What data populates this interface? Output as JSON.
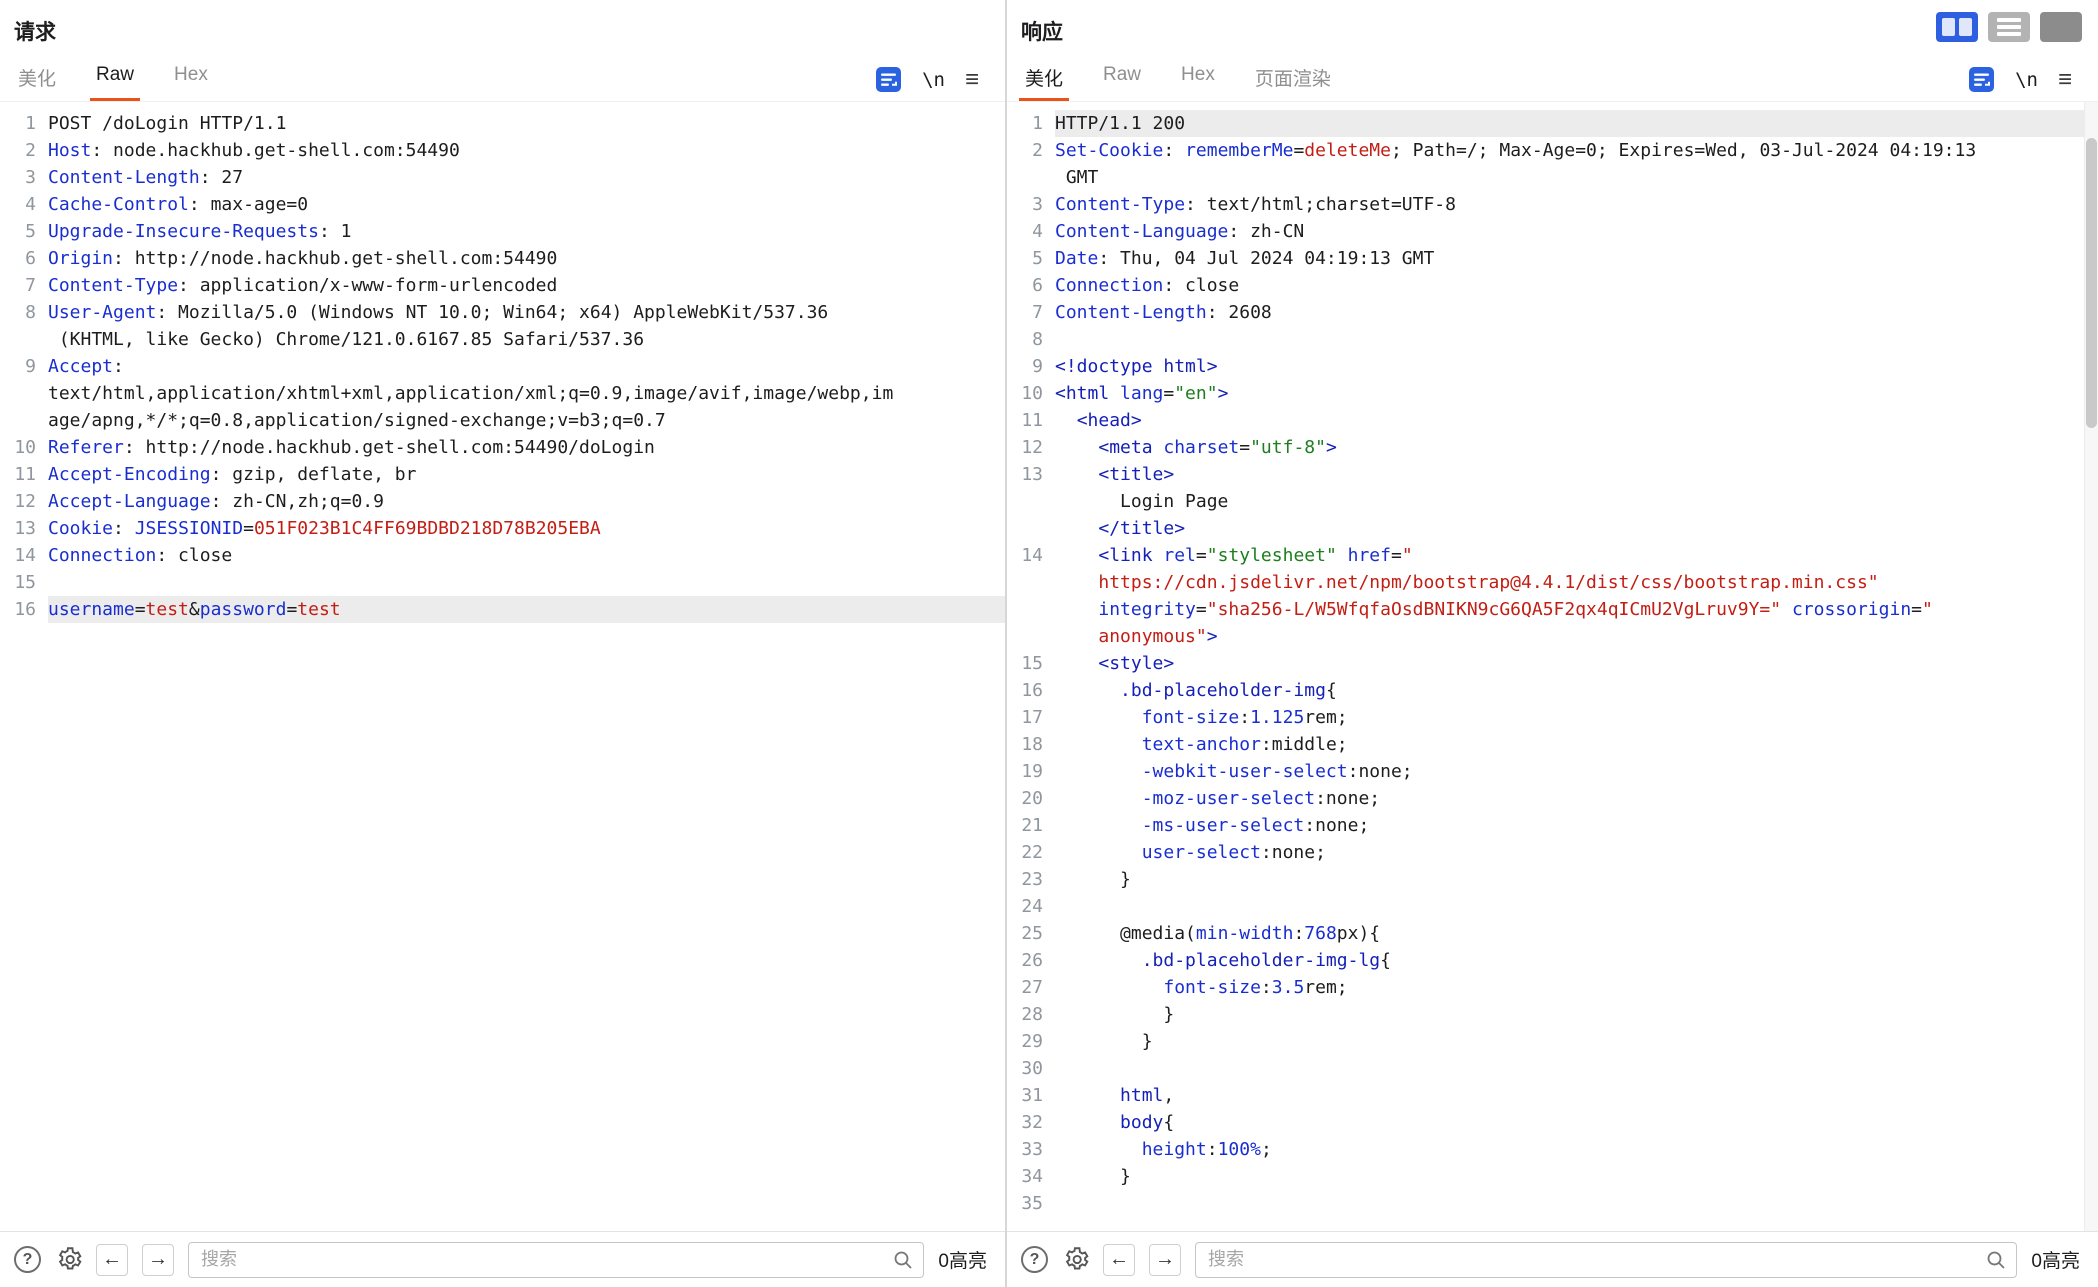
{
  "accent_color": "#e8531a",
  "icon_blue": "#2b62e0",
  "layout_toggles": {
    "split": "two-column-view",
    "rows": "stacked-view",
    "single": "single-view"
  },
  "glyphs": {
    "help": "?",
    "back": "←",
    "forward": "→",
    "menu": "≡",
    "newline": "\\n"
  },
  "request": {
    "title": "请求",
    "tabs": [
      {
        "label": "美化"
      },
      {
        "label": "Raw"
      },
      {
        "label": "Hex"
      }
    ],
    "footer": {
      "search_placeholder": "搜索",
      "highlight_label": "0高亮"
    },
    "lines": [
      {
        "n": 1,
        "rows": [
          [
            [
              "v",
              "POST /doLogin HTTP/1.1"
            ]
          ]
        ]
      },
      {
        "n": 2,
        "rows": [
          [
            [
              "k",
              "Host"
            ],
            [
              "v",
              ": node.hackhub.get-shell.com:54490"
            ]
          ]
        ]
      },
      {
        "n": 3,
        "rows": [
          [
            [
              "k",
              "Content-Length"
            ],
            [
              "v",
              ": 27"
            ]
          ]
        ]
      },
      {
        "n": 4,
        "rows": [
          [
            [
              "k",
              "Cache-Control"
            ],
            [
              "v",
              ": max-age=0"
            ]
          ]
        ]
      },
      {
        "n": 5,
        "rows": [
          [
            [
              "k",
              "Upgrade-Insecure-Requests"
            ],
            [
              "v",
              ": 1"
            ]
          ]
        ]
      },
      {
        "n": 6,
        "rows": [
          [
            [
              "k",
              "Origin"
            ],
            [
              "v",
              ": http://node.hackhub.get-shell.com:54490"
            ]
          ]
        ]
      },
      {
        "n": 7,
        "rows": [
          [
            [
              "k",
              "Content-Type"
            ],
            [
              "v",
              ": application/x-www-form-urlencoded"
            ]
          ]
        ]
      },
      {
        "n": 8,
        "rows": [
          [
            [
              "k",
              "User-Agent"
            ],
            [
              "v",
              ": Mozilla/5.0 (Windows NT 10.0; Win64; x64) AppleWebKit/537.36"
            ]
          ],
          [
            [
              "v",
              " (KHTML, like Gecko) Chrome/121.0.6167.85 Safari/537.36"
            ]
          ]
        ]
      },
      {
        "n": 9,
        "rows": [
          [
            [
              "k",
              "Accept"
            ],
            [
              "v",
              ":"
            ]
          ],
          [
            [
              "v",
              "text/html,application/xhtml+xml,application/xml;q=0.9,image/avif,image/webp,im"
            ]
          ],
          [
            [
              "v",
              "age/apng,*/*;q=0.8,application/signed-exchange;v=b3;q=0.7"
            ]
          ]
        ]
      },
      {
        "n": 10,
        "rows": [
          [
            [
              "k",
              "Referer"
            ],
            [
              "v",
              ": http://node.hackhub.get-shell.com:54490/doLogin"
            ]
          ]
        ]
      },
      {
        "n": 11,
        "rows": [
          [
            [
              "k",
              "Accept-Encoding"
            ],
            [
              "v",
              ": gzip, deflate, br"
            ]
          ]
        ]
      },
      {
        "n": 12,
        "rows": [
          [
            [
              "k",
              "Accept-Language"
            ],
            [
              "v",
              ": zh-CN,zh;q=0.9"
            ]
          ]
        ]
      },
      {
        "n": 13,
        "rows": [
          [
            [
              "k",
              "Cookie"
            ],
            [
              "v",
              ": "
            ],
            [
              "k",
              "JSESSIONID"
            ],
            [
              "v",
              "="
            ],
            [
              "s",
              "051F023B1C4FF69BDBD218D78B205EBA"
            ]
          ]
        ]
      },
      {
        "n": 14,
        "rows": [
          [
            [
              "k",
              "Connection"
            ],
            [
              "v",
              ": close"
            ]
          ]
        ]
      },
      {
        "n": 15,
        "rows": [
          [
            [
              "v",
              ""
            ]
          ]
        ]
      },
      {
        "n": 16,
        "hl": true,
        "rows": [
          [
            [
              "k",
              "username"
            ],
            [
              "v",
              "="
            ],
            [
              "s",
              "test"
            ],
            [
              "v",
              "&"
            ],
            [
              "k",
              "password"
            ],
            [
              "v",
              "="
            ],
            [
              "s",
              "test"
            ]
          ]
        ]
      }
    ]
  },
  "response": {
    "title": "响应",
    "tabs": [
      {
        "label": "美化"
      },
      {
        "label": "Raw"
      },
      {
        "label": "Hex"
      },
      {
        "label": "页面渲染"
      }
    ],
    "footer": {
      "search_placeholder": "搜索",
      "highlight_label": "0高亮"
    },
    "lines": [
      {
        "n": 1,
        "hl": true,
        "rows": [
          [
            [
              "v",
              "HTTP/1.1 200"
            ]
          ]
        ]
      },
      {
        "n": 2,
        "rows": [
          [
            [
              "k",
              "Set-Cookie"
            ],
            [
              "v",
              ": "
            ],
            [
              "k",
              "rememberMe"
            ],
            [
              "v",
              "="
            ],
            [
              "s",
              "deleteMe"
            ],
            [
              "v",
              "; Path=/; Max-Age=0; Expires=Wed, 03-Jul-2024 04:19:13"
            ]
          ],
          [
            [
              "v",
              " GMT"
            ]
          ]
        ]
      },
      {
        "n": 3,
        "rows": [
          [
            [
              "k",
              "Content-Type"
            ],
            [
              "v",
              ": text/html;charset=UTF-8"
            ]
          ]
        ]
      },
      {
        "n": 4,
        "rows": [
          [
            [
              "k",
              "Content-Language"
            ],
            [
              "v",
              ": zh-CN"
            ]
          ]
        ]
      },
      {
        "n": 5,
        "rows": [
          [
            [
              "k",
              "Date"
            ],
            [
              "v",
              ": Thu, 04 Jul 2024 04:19:13 GMT"
            ]
          ]
        ]
      },
      {
        "n": 6,
        "rows": [
          [
            [
              "k",
              "Connection"
            ],
            [
              "v",
              ": close"
            ]
          ]
        ]
      },
      {
        "n": 7,
        "rows": [
          [
            [
              "k",
              "Content-Length"
            ],
            [
              "v",
              ": 2608"
            ]
          ]
        ]
      },
      {
        "n": 8,
        "rows": [
          [
            [
              "v",
              ""
            ]
          ]
        ]
      },
      {
        "n": 9,
        "rows": [
          [
            [
              "t",
              "<!doctype html>"
            ]
          ]
        ]
      },
      {
        "n": 10,
        "rows": [
          [
            [
              "t",
              "<html"
            ],
            [
              "k",
              " lang"
            ],
            [
              "v",
              "="
            ],
            [
              "g",
              "\"en\""
            ],
            [
              "t",
              ">"
            ]
          ]
        ]
      },
      {
        "n": 11,
        "rows": [
          [
            [
              "v",
              "  "
            ],
            [
              "t",
              "<head>"
            ]
          ]
        ]
      },
      {
        "n": 12,
        "rows": [
          [
            [
              "v",
              "    "
            ],
            [
              "t",
              "<meta"
            ],
            [
              "k",
              " charset"
            ],
            [
              "v",
              "="
            ],
            [
              "g",
              "\"utf-8\""
            ],
            [
              "t",
              ">"
            ]
          ]
        ]
      },
      {
        "n": 13,
        "rows": [
          [
            [
              "v",
              "    "
            ],
            [
              "t",
              "<title>"
            ]
          ],
          [
            [
              "v",
              "      Login Page"
            ]
          ],
          [
            [
              "v",
              "    "
            ],
            [
              "t",
              "</title>"
            ]
          ]
        ]
      },
      {
        "n": 14,
        "rows": [
          [
            [
              "v",
              "    "
            ],
            [
              "t",
              "<link"
            ],
            [
              "k",
              " rel"
            ],
            [
              "v",
              "="
            ],
            [
              "g",
              "\"stylesheet\""
            ],
            [
              "k",
              " href"
            ],
            [
              "v",
              "="
            ],
            [
              "s",
              "\""
            ]
          ],
          [
            [
              "v",
              "    "
            ],
            [
              "s",
              "https://cdn.jsdelivr.net/npm/bootstrap@4.4.1/dist/css/bootstrap.min.css\""
            ]
          ],
          [
            [
              "v",
              "    "
            ],
            [
              "k",
              "integrity"
            ],
            [
              "v",
              "="
            ],
            [
              "s",
              "\"sha256-L/W5WfqfaOsdBNIKN9cG6QA5F2qx4qICmU2VgLruv9Y=\""
            ],
            [
              "k",
              " crossorigin"
            ],
            [
              "v",
              "="
            ],
            [
              "s",
              "\""
            ]
          ],
          [
            [
              "v",
              "    "
            ],
            [
              "s",
              "anonymous\""
            ],
            [
              "t",
              ">"
            ]
          ]
        ]
      },
      {
        "n": 15,
        "rows": [
          [
            [
              "v",
              "    "
            ],
            [
              "t",
              "<style>"
            ]
          ]
        ]
      },
      {
        "n": 16,
        "rows": [
          [
            [
              "v",
              "      "
            ],
            [
              "t",
              ".bd-placeholder-img"
            ],
            [
              "v",
              "{"
            ]
          ]
        ]
      },
      {
        "n": 17,
        "rows": [
          [
            [
              "v",
              "        "
            ],
            [
              "k",
              "font-size"
            ],
            [
              "v",
              ":"
            ],
            [
              "k",
              "1.125"
            ],
            [
              "v",
              "rem;"
            ]
          ]
        ]
      },
      {
        "n": 18,
        "rows": [
          [
            [
              "v",
              "        "
            ],
            [
              "k",
              "text-anchor"
            ],
            [
              "v",
              ":middle;"
            ]
          ]
        ]
      },
      {
        "n": 19,
        "rows": [
          [
            [
              "v",
              "        "
            ],
            [
              "k",
              "-webkit-user-select"
            ],
            [
              "v",
              ":none;"
            ]
          ]
        ]
      },
      {
        "n": 20,
        "rows": [
          [
            [
              "v",
              "        "
            ],
            [
              "k",
              "-moz-user-select"
            ],
            [
              "v",
              ":none;"
            ]
          ]
        ]
      },
      {
        "n": 21,
        "rows": [
          [
            [
              "v",
              "        "
            ],
            [
              "k",
              "-ms-user-select"
            ],
            [
              "v",
              ":none;"
            ]
          ]
        ]
      },
      {
        "n": 22,
        "rows": [
          [
            [
              "v",
              "        "
            ],
            [
              "k",
              "user-select"
            ],
            [
              "v",
              ":none;"
            ]
          ]
        ]
      },
      {
        "n": 23,
        "rows": [
          [
            [
              "v",
              "      }"
            ]
          ]
        ]
      },
      {
        "n": 24,
        "rows": [
          [
            [
              "v",
              ""
            ]
          ]
        ]
      },
      {
        "n": 25,
        "rows": [
          [
            [
              "v",
              "      @media("
            ],
            [
              "k",
              "min-width"
            ],
            [
              "v",
              ":"
            ],
            [
              "k",
              "768"
            ],
            [
              "v",
              "px){"
            ]
          ]
        ]
      },
      {
        "n": 26,
        "rows": [
          [
            [
              "v",
              "        "
            ],
            [
              "t",
              ".bd-placeholder-img-lg"
            ],
            [
              "v",
              "{"
            ]
          ]
        ]
      },
      {
        "n": 27,
        "rows": [
          [
            [
              "v",
              "          "
            ],
            [
              "k",
              "font-size"
            ],
            [
              "v",
              ":"
            ],
            [
              "k",
              "3.5"
            ],
            [
              "v",
              "rem;"
            ]
          ]
        ]
      },
      {
        "n": 28,
        "rows": [
          [
            [
              "v",
              "          }"
            ]
          ]
        ]
      },
      {
        "n": 29,
        "rows": [
          [
            [
              "v",
              "        }"
            ]
          ]
        ]
      },
      {
        "n": 30,
        "rows": [
          [
            [
              "v",
              ""
            ]
          ]
        ]
      },
      {
        "n": 31,
        "rows": [
          [
            [
              "v",
              "      "
            ],
            [
              "t",
              "html"
            ],
            [
              "v",
              ","
            ]
          ]
        ]
      },
      {
        "n": 32,
        "rows": [
          [
            [
              "v",
              "      "
            ],
            [
              "t",
              "body"
            ],
            [
              "v",
              "{"
            ]
          ]
        ]
      },
      {
        "n": 33,
        "rows": [
          [
            [
              "v",
              "        "
            ],
            [
              "k",
              "height"
            ],
            [
              "v",
              ":"
            ],
            [
              "k",
              "100%"
            ],
            [
              "v",
              ";"
            ]
          ]
        ]
      },
      {
        "n": 34,
        "rows": [
          [
            [
              "v",
              "      }"
            ]
          ]
        ]
      },
      {
        "n": 35,
        "rows": [
          [
            [
              "v",
              ""
            ]
          ]
        ]
      }
    ]
  }
}
